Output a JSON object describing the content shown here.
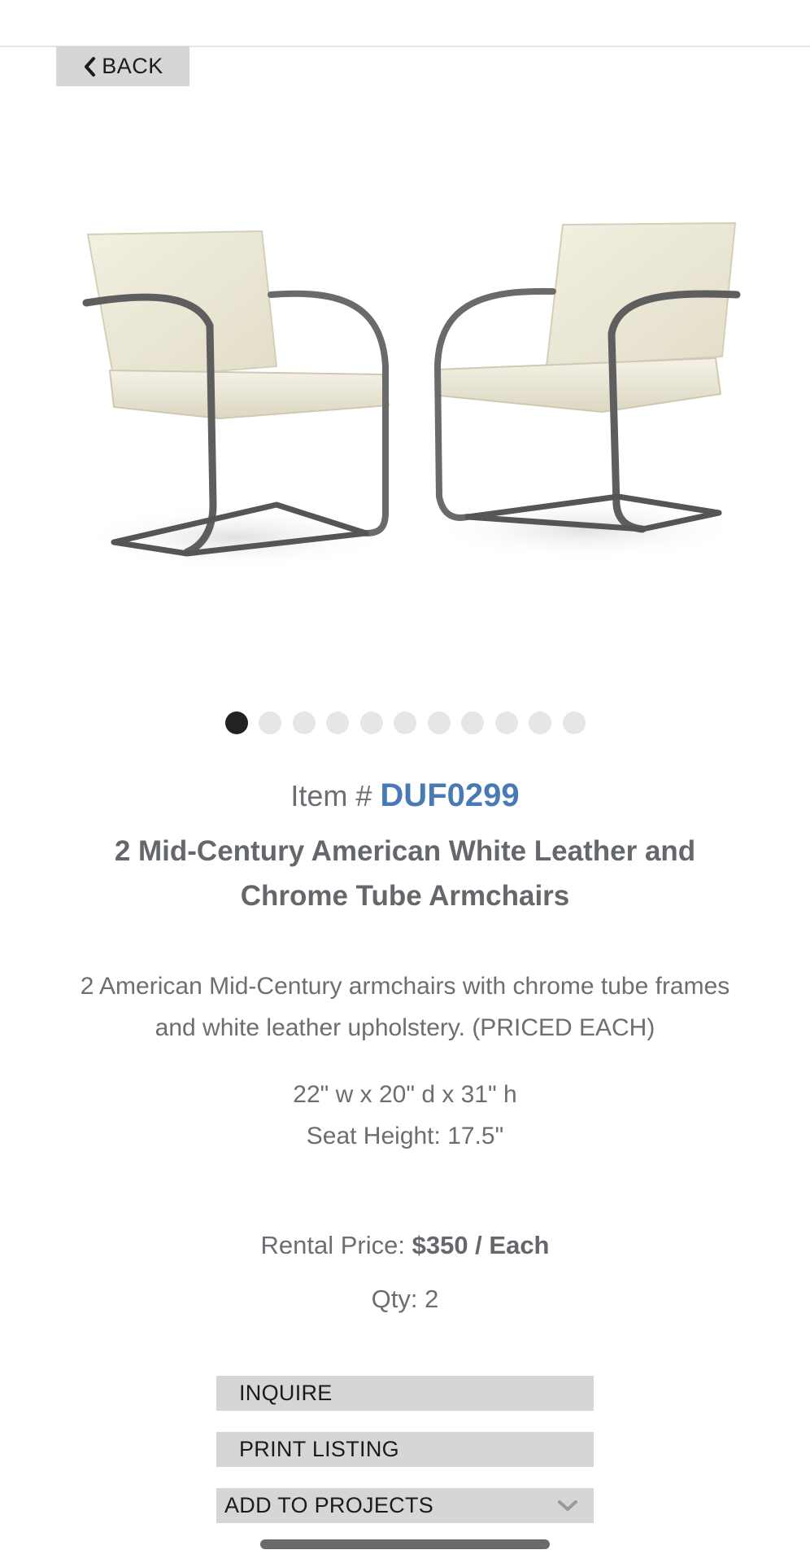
{
  "nav": {
    "back_label": "BACK"
  },
  "carousel": {
    "total": 11,
    "active_index": 0
  },
  "item": {
    "prefix": "Item #",
    "code": "DUF0299",
    "title": "2 Mid-Century American White Leather and Chrome Tube Armchairs",
    "description": "2 American Mid-Century armchairs with chrome tube frames and white leather upholstery. (PRICED EACH)",
    "dimensions": "22\" w x 20\" d x 31\" h",
    "seat_height": "Seat Height: 17.5\""
  },
  "pricing": {
    "rental_label": "Rental Price:",
    "rental_value": "$350 / Each",
    "qty": "Qty: 2"
  },
  "actions": {
    "inquire": "INQUIRE",
    "print": "PRINT LISTING",
    "add_to_projects": "ADD TO PROJECTS"
  },
  "colors": {
    "item_code": "#4a7ab5",
    "button_bg": "#d6d6d6",
    "text": "#6b6e72",
    "active_dot": "#222222",
    "inactive_dot": "#e6e6e6"
  },
  "icons": {
    "back": "chevron-left-icon",
    "dropdown": "chevron-down-icon"
  }
}
